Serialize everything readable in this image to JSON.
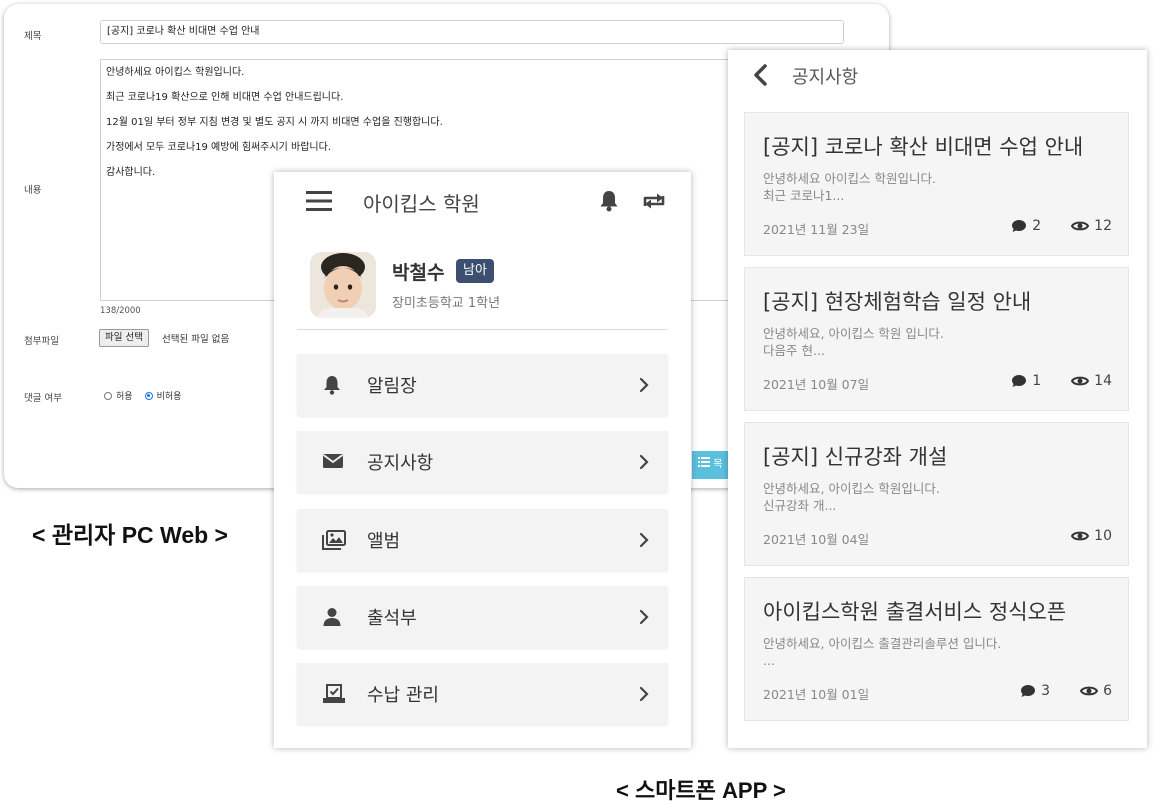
{
  "admin": {
    "title_label": "제목",
    "title_value": "[공지] 코로나 확산 비대면 수업 안내",
    "content_label": "내용",
    "content_lines": [
      "안녕하세요 아이킵스 학원입니다.",
      "최근 코로나19 확산으로 인해 비대면 수업 안내드립니다.",
      "12월 01일 부터 정부 지침 변경 및 별도 공지 시 까지 비대면 수업을 진행합니다.",
      "가정에서 모두 코로나19 예방에 힘써주시기 바랍니다.",
      "감사합니다."
    ],
    "char_count": "138/2000",
    "attachment_label": "첨부파일",
    "file_button": "파일 선택",
    "file_status": "선택된 파일 없음",
    "comment_label": "댓글 여부",
    "comment_options": [
      "허용",
      "비허용"
    ],
    "comment_selected": "비허용",
    "list_button": "목"
  },
  "captions": {
    "admin": "< 관리자 PC Web >",
    "app": "< 스마트폰 APP >"
  },
  "app": {
    "title": "아이킵스 학원",
    "student_name": "박철수",
    "student_badge": "남아",
    "student_school": "장미초등학교 1학년",
    "menu": [
      {
        "label": "알림장",
        "icon": "bell-icon"
      },
      {
        "label": "공지사항",
        "icon": "envelope-icon"
      },
      {
        "label": "앨범",
        "icon": "album-icon"
      },
      {
        "label": "출석부",
        "icon": "person-icon"
      },
      {
        "label": "수납 관리",
        "icon": "payment-icon"
      }
    ]
  },
  "notice": {
    "title": "공지사항",
    "items": [
      {
        "title": "[공지] 코로나 확산 비대면 수업 안내",
        "excerpt": "안녕하세요 아이킵스 학원입니다.\n최근 코로나1...",
        "date": "2021년 11월 23일",
        "comments": "2",
        "views": "12"
      },
      {
        "title": "[공지] 현장체험학습 일정 안내",
        "excerpt": "안녕하세요, 아이킵스 학원 입니다.\n다음주 현...",
        "date": "2021년 10월 07일",
        "comments": "1",
        "views": "14"
      },
      {
        "title": "[공지] 신규강좌 개설",
        "excerpt": "안녕하세요, 아이킵스 학원입니다.\n신규강좌 개...",
        "date": "2021년 10월 04일",
        "comments": "",
        "views": "10"
      },
      {
        "title": "아이킵스학원 출결서비스 정식오픈",
        "excerpt": "안녕하세요, 아이킵스 출결관리솔루션 입니다.\n...",
        "date": "2021년 10월 01일",
        "comments": "3",
        "views": "6"
      }
    ]
  },
  "colors": {
    "badge": "#3c4f6e",
    "list_button": "#5bc0de",
    "radio_selected": "#1a73e8"
  }
}
